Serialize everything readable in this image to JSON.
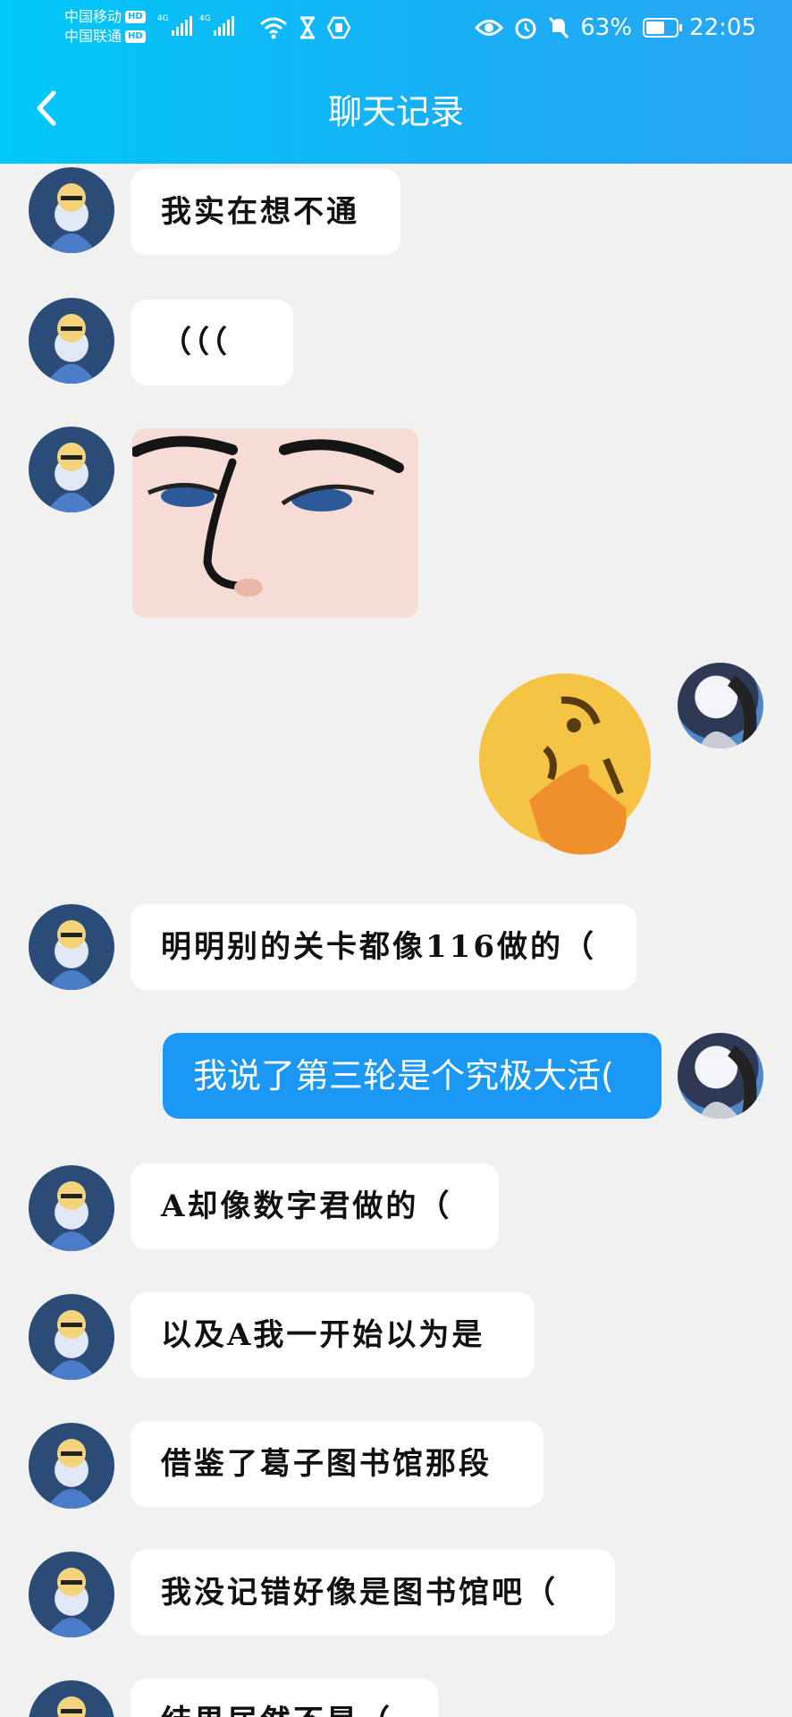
{
  "status_bar": {
    "carrier1": "中国移动",
    "carrier2": "中国联通",
    "hd_label": "HD",
    "network1": "4G",
    "network2": "4G",
    "battery_percent": "63%",
    "battery_level": 0.63,
    "time": "22:05"
  },
  "header": {
    "title": "聊天记录",
    "back_icon": "chevron-left-icon"
  },
  "colors": {
    "header_gradient_start": "#00c8f8",
    "header_gradient_end": "#2aa5f5",
    "chat_background": "#f1f1f1",
    "incoming_bubble": "#ffffff",
    "outgoing_bubble": "#1a98f3"
  },
  "messages": [
    {
      "side": "left",
      "type": "text",
      "text": "我实在想不通"
    },
    {
      "side": "left",
      "type": "text",
      "text": "（（（"
    },
    {
      "side": "left",
      "type": "sticker",
      "sticker": "face-closeup-sticker"
    },
    {
      "side": "right",
      "type": "sticker",
      "sticker": "thinking-emoji-sticker"
    },
    {
      "side": "left",
      "type": "text",
      "text": "明明别的关卡都像116做的（"
    },
    {
      "side": "right",
      "type": "text",
      "text": "我说了第三轮是个究极大活("
    },
    {
      "side": "left",
      "type": "text",
      "text": "A却像数字君做的（"
    },
    {
      "side": "left",
      "type": "text",
      "text": "以及A我一开始以为是"
    },
    {
      "side": "left",
      "type": "text",
      "text": "借鉴了葛子图书馆那段"
    },
    {
      "side": "left",
      "type": "text",
      "text": "我没记错好像是图书馆吧（"
    },
    {
      "side": "left",
      "type": "text",
      "text": "结果居然不是（"
    }
  ]
}
